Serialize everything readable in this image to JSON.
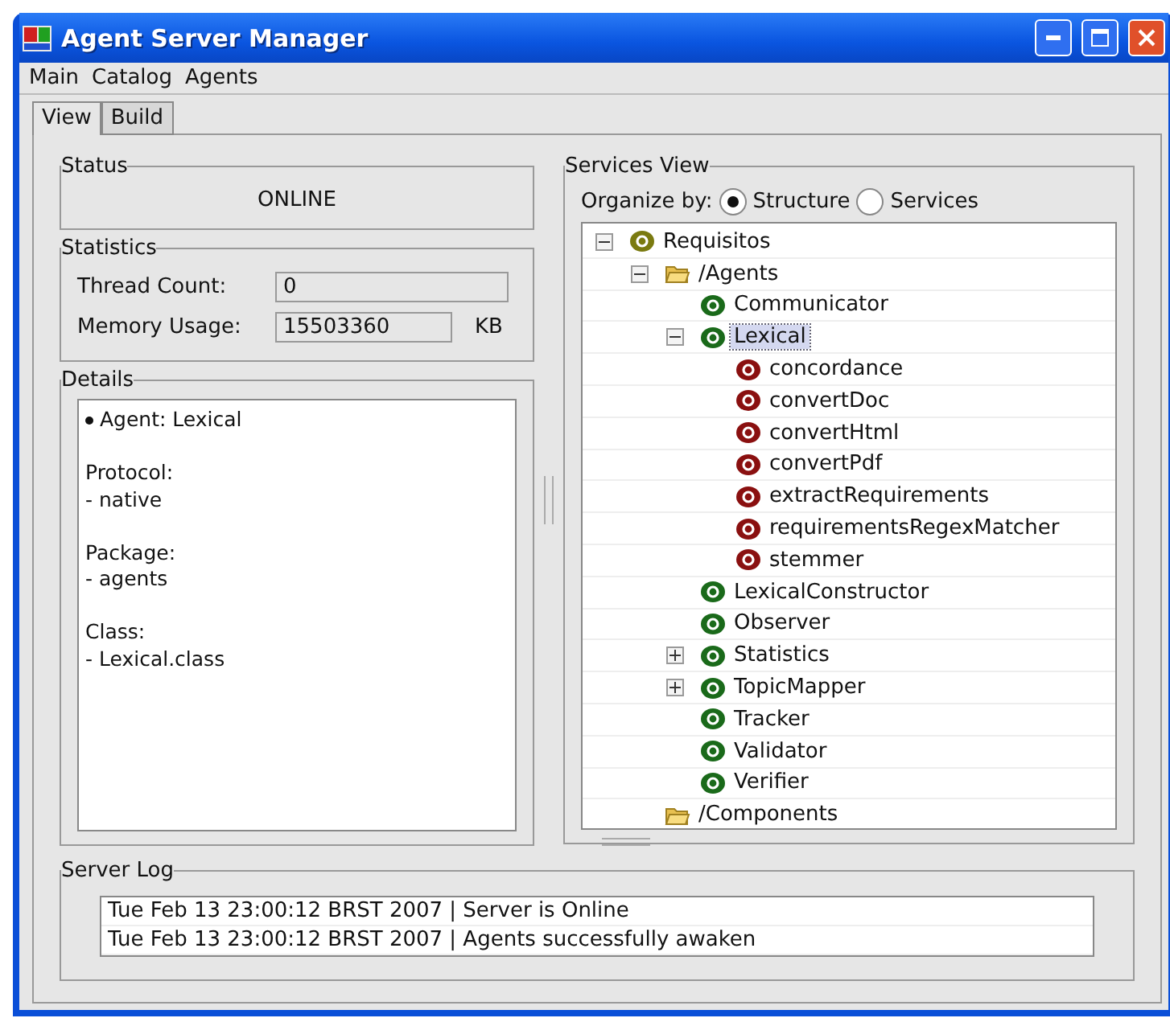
{
  "window": {
    "title": "Agent Server Manager"
  },
  "menu": [
    "Main",
    "Catalog",
    "Agents"
  ],
  "tabs": [
    {
      "label": "View",
      "selected": true
    },
    {
      "label": "Build",
      "selected": false
    }
  ],
  "status": {
    "title": "Status",
    "value": "ONLINE"
  },
  "statistics": {
    "title": "Statistics",
    "fields": [
      {
        "label": "Thread Count:",
        "value": "0"
      },
      {
        "label": "Memory Usage:",
        "value": "15503360",
        "unit": "KB"
      }
    ]
  },
  "details": {
    "title": "Details",
    "agent": "Agent: Lexical",
    "sections": [
      {
        "label": "Protocol:",
        "value": "- native"
      },
      {
        "label": "Package:",
        "value": "- agents"
      },
      {
        "label": "Class:",
        "value": "- Lexical.class"
      }
    ]
  },
  "services": {
    "title": "Services View",
    "organize_label": "Organize by:",
    "options": [
      {
        "label": "Structure",
        "selected": true
      },
      {
        "label": "Services",
        "selected": false
      }
    ],
    "tree": [
      {
        "label": "Requisitos",
        "kind": "root",
        "expanded": true,
        "selected": false,
        "children": [
          {
            "label": "/Agents",
            "kind": "folder",
            "expanded": true,
            "selected": false,
            "children": [
              {
                "label": "Communicator",
                "kind": "agent",
                "selected": false
              },
              {
                "label": "Lexical",
                "kind": "agent",
                "expanded": true,
                "selected": true,
                "children": [
                  {
                    "label": "concordance",
                    "kind": "service",
                    "selected": false
                  },
                  {
                    "label": "convertDoc",
                    "kind": "service",
                    "selected": false
                  },
                  {
                    "label": "convertHtml",
                    "kind": "service",
                    "selected": false
                  },
                  {
                    "label": "convertPdf",
                    "kind": "service",
                    "selected": false
                  },
                  {
                    "label": "extractRequirements",
                    "kind": "service",
                    "selected": false
                  },
                  {
                    "label": "requirementsRegexMatcher",
                    "kind": "service",
                    "selected": false
                  },
                  {
                    "label": "stemmer",
                    "kind": "service",
                    "selected": false
                  }
                ]
              },
              {
                "label": "LexicalConstructor",
                "kind": "agent",
                "selected": false
              },
              {
                "label": "Observer",
                "kind": "agent",
                "selected": false
              },
              {
                "label": "Statistics",
                "kind": "agent",
                "expanded": false,
                "selected": false
              },
              {
                "label": "TopicMapper",
                "kind": "agent",
                "expanded": false,
                "selected": false
              },
              {
                "label": "Tracker",
                "kind": "agent",
                "selected": false
              },
              {
                "label": "Validator",
                "kind": "agent",
                "selected": false
              },
              {
                "label": "Verifier",
                "kind": "agent",
                "selected": false
              }
            ]
          },
          {
            "label": "/Components",
            "kind": "folder",
            "selected": false
          }
        ]
      }
    ]
  },
  "server_log": {
    "title": "Server Log",
    "entries": [
      "Tue Feb 13 23:00:12 BRST 2007 | Server is Online",
      "Tue Feb 13 23:00:12 BRST 2007 | Agents successfully awaken"
    ]
  }
}
